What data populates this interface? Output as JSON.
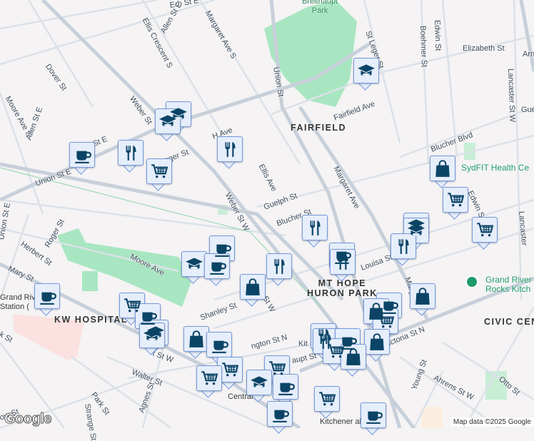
{
  "map": {
    "areas": [
      "FAIRFIELD",
      "MT HOPE\nHURON PARK",
      "KW HOSPITAL",
      "CIVIC CEN"
    ],
    "parks": [
      "Breithaupt\nPark"
    ],
    "pois": [
      "Grand River\nRocks Kitch",
      "SydFIT Health Ce",
      "Grand Riv\nStation (",
      "Central",
      "Kitchener   all"
    ],
    "streets": [
      "Erb St E",
      "Erb St E",
      "Allen St E",
      "Ellis Crescent S",
      "Margaret Ave S",
      "Union St",
      "Elizabeth St",
      "Boehmer St",
      "Edwin St",
      "St Leger St",
      "Lancaster St W",
      "Dover St",
      "Moore Ave S",
      "Allen St E",
      "Weber St",
      "Fairfield Ave",
      "H Ave",
      "Roger St",
      "Union St E",
      "Ellis Ave",
      "Weber St W",
      "Margaret Ave",
      "Blucher Blvd",
      "Guelph St",
      "Blucher St",
      "Herbert St",
      "Roger St",
      "Mary St",
      "Moore Ave",
      "Duke St W",
      "Louisa St",
      "Edwin St",
      "Lancaster",
      "Shanley St",
      "ngton St N",
      "Victoria St N",
      "Marg  ve",
      "t St W",
      "Kit",
      "aupt St",
      "Walter St",
      "Agnes St",
      "Park St",
      "Strange St",
      "ow St",
      "Young St",
      "Ahrens St W",
      "Otto St",
      "Union St E",
      "k St",
      "Gue",
      "Arn"
    ],
    "attribution": "Map data ©2025 Google",
    "logo": "Google"
  },
  "marker_types": [
    "coffee-shop",
    "restaurant",
    "grocery",
    "school",
    "shopping"
  ],
  "colors": {
    "marker_bg": "#e6eefb",
    "marker_border": "#7599dc",
    "icon": "#0b4466",
    "park": "#a8e6c1",
    "hospital": "#fbe1df"
  }
}
